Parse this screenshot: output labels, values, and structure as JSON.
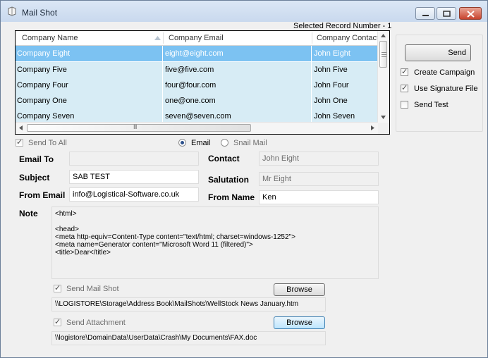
{
  "window": {
    "title": "Mail Shot",
    "minimize_icon": "minimize-icon",
    "maximize_icon": "maximize-icon",
    "close_icon": "close-icon"
  },
  "record": {
    "label": "Selected Record Number - 1"
  },
  "grid": {
    "columns": [
      "Company Name",
      "Company Email",
      "Company Contact"
    ],
    "rows": [
      {
        "name": "Company Eight",
        "email": "eight@eight.com",
        "contact": "John Eight",
        "selected": true
      },
      {
        "name": "Company Five",
        "email": "five@five.com",
        "contact": "John Five",
        "selected": false
      },
      {
        "name": "Company Four",
        "email": "four@four.com",
        "contact": "John Four",
        "selected": false
      },
      {
        "name": "Company One",
        "email": "one@one.com",
        "contact": "John One",
        "selected": false
      },
      {
        "name": "Company Seven",
        "email": "seven@seven.com",
        "contact": "John Seven",
        "selected": false
      }
    ],
    "hscroll_thumb": "III"
  },
  "options": {
    "send_button": "Send",
    "create_campaign": "Create Campaign",
    "use_signature": "Use Signature File",
    "send_test": "Send Test"
  },
  "form": {
    "send_to_all": "Send To All",
    "email_radio": "Email",
    "snail_radio": "Snail Mail",
    "email_to_label": "Email To",
    "email_to_value": "",
    "contact_label": "Contact",
    "contact_value": "John Eight",
    "subject_label": "Subject",
    "subject_value": "SAB TEST",
    "salutation_label": "Salutation",
    "salutation_value": "Mr Eight",
    "from_email_label": "From Email",
    "from_email_value": "info@Logistical-Software.co.uk",
    "from_name_label": "From Name",
    "from_name_value": "Ken",
    "note_label": "Note",
    "note_lines": [
      "<html>",
      "",
      "<head>",
      "<meta http-equiv=Content-Type content=\"text/html; charset=windows-1252\">",
      "<meta name=Generator content=\"Microsoft Word 11 (filtered)\">",
      "<title>Dear</title>"
    ]
  },
  "mailshot": {
    "send_mail_shot": "Send Mail Shot",
    "browse1": "Browse",
    "path1": "\\\\LOGISTORE\\Storage\\Address Book\\MailShots\\WellStock News January.htm",
    "send_attachment": "Send Attachment",
    "browse2": "Browse",
    "path2": "\\\\logistore\\DomainData\\UserData\\Crash\\My Documents\\FAX.doc"
  }
}
